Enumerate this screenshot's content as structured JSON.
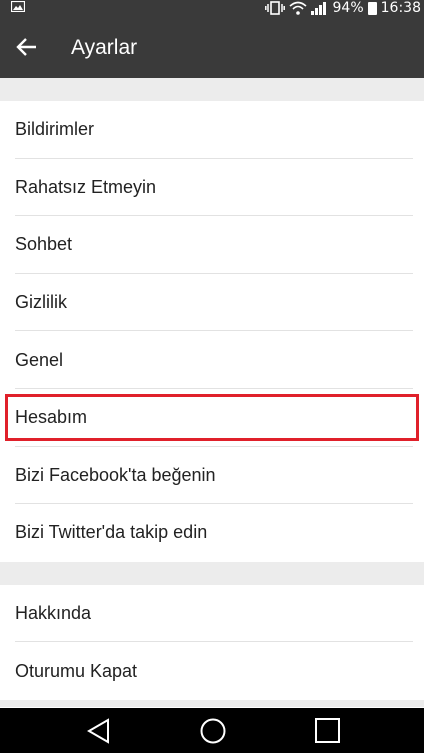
{
  "status_bar": {
    "battery_percent": "94%",
    "time": "16:38",
    "icons": [
      "gallery-icon",
      "vibrate-icon",
      "wifi-icon",
      "signal-icon",
      "battery-icon"
    ]
  },
  "app_bar": {
    "title": "Ayarlar",
    "back_icon": "arrow-back-icon"
  },
  "settings": {
    "group1": [
      {
        "label": "Bildirimler"
      },
      {
        "label": "Rahatsız Etmeyin"
      },
      {
        "label": "Sohbet"
      },
      {
        "label": "Gizlilik"
      },
      {
        "label": "Genel"
      },
      {
        "label": "Hesabım",
        "highlighted": true
      },
      {
        "label": "Bizi Facebook'ta beğenin"
      },
      {
        "label": "Bizi Twitter'da takip edin"
      }
    ],
    "group2": [
      {
        "label": "Hakkında"
      },
      {
        "label": "Oturumu Kapat"
      }
    ]
  },
  "nav_bar": {
    "icons": [
      "back-triangle-icon",
      "home-circle-icon",
      "recents-square-icon"
    ]
  },
  "colors": {
    "bar": "#3a3a3a",
    "divider_gap": "#ececec",
    "highlight_border": "#e0202a"
  }
}
